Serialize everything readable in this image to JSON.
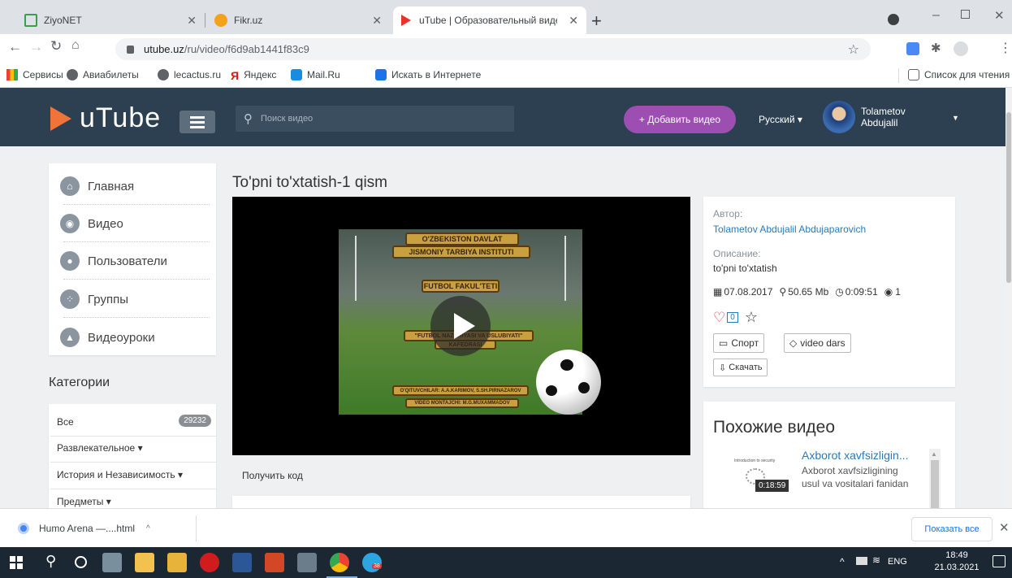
{
  "browser": {
    "tabs": [
      {
        "title": "ZiyoNET"
      },
      {
        "title": "Fikr.uz"
      },
      {
        "title": "uTube | Образовательный виде"
      }
    ],
    "url_host": "utube.uz",
    "url_path": "/ru/video/f6d9ab1441f83c9",
    "bookmarks": [
      "Сервисы",
      "Авиабилеты",
      "lecactus.ru",
      "Яндекс",
      "Mail.Ru",
      "Искать в Интернете"
    ],
    "reading_list": "Список для чтения"
  },
  "site": {
    "logo": "uTube",
    "search_placeholder": "Поиск видео",
    "add_video": "+ Добавить видео",
    "language": "Русский",
    "user_first": "Tolametov",
    "user_last": "Abdujalil"
  },
  "sidebar": {
    "items": [
      {
        "label": "Главная",
        "icon": "home-icon"
      },
      {
        "label": "Видео",
        "icon": "eye-icon"
      },
      {
        "label": "Пользователи",
        "icon": "user-icon"
      },
      {
        "label": "Группы",
        "icon": "group-icon"
      },
      {
        "label": "Видеоуроки",
        "icon": "graduation-icon"
      }
    ],
    "categories_title": "Категории",
    "categories": [
      {
        "label": "Все",
        "count": "29232"
      },
      {
        "label": "Развлекательное"
      },
      {
        "label": "История и Независимость"
      },
      {
        "label": "Предметы"
      }
    ]
  },
  "video": {
    "title": "To'pni to'xtatish-1 qism",
    "get_code": "Получить код",
    "thumbnail_text": {
      "institute_1": "O'ZBEKISTON DAVLAT",
      "institute_2": "JISMONIY TARBIYA INSTITUTI",
      "faculty": "FUTBOL FAKUL'TETI",
      "department_1": "\"FUTBOL NAZARIYASI VA USLUBIYATI\"",
      "department_2": "KAFEDRASI",
      "authors": "O'QITUVCHILAR: A.A.KARIMOV, S.SH.PIRNAZAROV",
      "montage": "VIDEO MONTAJCHI: M.G.MUXAMMADOV"
    }
  },
  "details": {
    "author_label": "Автор:",
    "author": "Tolametov Abdujalil Abdujaparovich",
    "description_label": "Описание:",
    "description": "to'pni to'xtatish",
    "date": "07.08.2017",
    "size": "50.65 Mb",
    "duration": "0:09:51",
    "views": "1",
    "likes": "0",
    "category_tag": "Спорт",
    "keyword_tag": "video dars",
    "download": "Скачать"
  },
  "related": {
    "title": "Похожие видео",
    "items": [
      {
        "title": "Axborot xavfsizligin...",
        "description_1": "Axborot xavfsizligining",
        "description_2": "usul va vositalari fanidan",
        "duration": "0:18:59",
        "thumb_caption": "Introduction to security"
      }
    ]
  },
  "download_bar": {
    "file": "Humo Arena —....html",
    "show_all": "Показать все"
  },
  "taskbar": {
    "lang": "ENG",
    "time": "18:49",
    "date": "21.03.2021",
    "badge": "38"
  },
  "colors": {
    "header": "#2d4051",
    "accent_purple": "#9c4fb0",
    "link": "#2a7ab8",
    "like_red": "#d9363e"
  }
}
